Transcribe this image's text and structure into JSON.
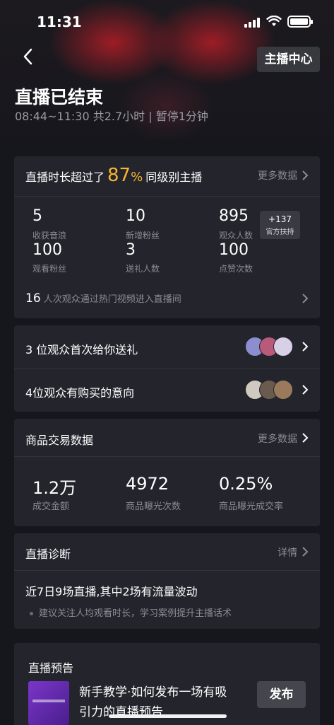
{
  "status": {
    "time": "11:31"
  },
  "header": {
    "host_center": "主播中心",
    "title": "直播已结束",
    "subtitle": "08:44~11:30  共2.7小时 | 暂停1分钟"
  },
  "overview": {
    "prefix": "直播时长超过了",
    "percent": "87",
    "percent_sign": "%",
    "suffix": "同级别主播",
    "more": "更多数据",
    "stats": [
      {
        "value": "5",
        "label": "收获音浪"
      },
      {
        "value": "10",
        "label": "新增粉丝"
      },
      {
        "value": "895",
        "label": "观众人数"
      },
      {
        "value": "100",
        "label": "观看粉丝"
      },
      {
        "value": "3",
        "label": "送礼人数"
      },
      {
        "value": "100",
        "label": "点赞次数"
      }
    ],
    "badge": {
      "line1": "+137",
      "line2": "官方扶持"
    },
    "hot_count": "16",
    "hot_text": "人次观众通过热门视频进入直播间"
  },
  "gift_row": {
    "text": "3 位观众首次给你送礼"
  },
  "buy_row": {
    "text": "4位观众有购买的意向"
  },
  "goods": {
    "title": "商品交易数据",
    "more": "更多数据",
    "stats": [
      {
        "value": "1.2万",
        "label": "成交金额"
      },
      {
        "value": "4972",
        "label": "商品曝光次数"
      },
      {
        "value": "0.25%",
        "label": "商品曝光成交率"
      }
    ]
  },
  "diagnosis": {
    "title": "直播诊断",
    "more": "详情",
    "headline": "近7日9场直播,其中2场有流量波动",
    "tip": "建议关注人均观看时长，学习案例提升主播话术"
  },
  "preview": {
    "title": "直播预告",
    "desc_line1": "新手教学·如何发布一场有吸",
    "desc_line2": "引力的直播预告",
    "publish": "发布"
  },
  "colors": {
    "accent": "#f6b52e",
    "card": "#24242c",
    "bg": "#16161d"
  }
}
